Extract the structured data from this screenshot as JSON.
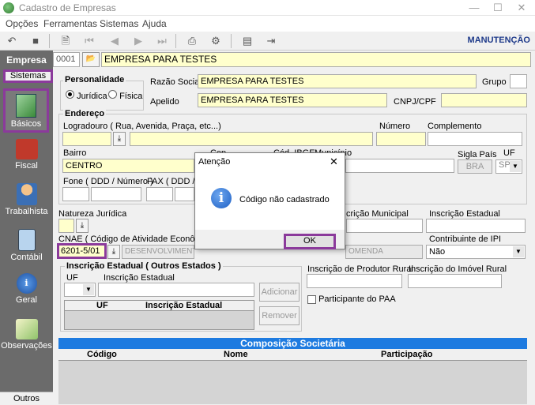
{
  "window": {
    "title": "Cadastro de Empresas"
  },
  "menu": {
    "items": [
      "Opções",
      "Ferramentas",
      "Sistemas",
      "Ajuda"
    ]
  },
  "toolbar": {
    "mode": "MANUTENÇÃO"
  },
  "empresa": {
    "tab": "Empresa",
    "code": "0001",
    "name": "EMPRESA PARA TESTES"
  },
  "sidebar": {
    "sistemas_tab": "Sistemas",
    "items": [
      "Básicos",
      "Fiscal",
      "Trabalhista",
      "Contábil",
      "Geral",
      "Observações"
    ],
    "outros": "Outros"
  },
  "personalidade": {
    "title": "Personalidade",
    "juridica": "Jurídica",
    "fisica": "Física"
  },
  "form": {
    "razao_social_label": "Razão Social",
    "razao_social": "EMPRESA PARA TESTES",
    "grupo_label": "Grupo",
    "apelido_label": "Apelido",
    "apelido": "EMPRESA PARA TESTES",
    "cnpj_label": "CNPJ/CPF"
  },
  "endereco": {
    "title": "Endereço",
    "logradouro_label": "Logradouro ( Rua, Avenida, Praça, etc...)",
    "numero_label": "Número",
    "complemento_label": "Complemento",
    "bairro_label": "Bairro",
    "bairro": "CENTRO",
    "cep_label": "Cep",
    "cod_ibge_label": "Cód. IBGE",
    "municipio_label": "Município",
    "sigla_pais_label": "Sigla País",
    "sigla_pais": "BRA",
    "uf_label": "UF",
    "uf": "SP",
    "fone_label": "Fone ( DDD / Número )",
    "fax_label": "FAX ( DDD / N"
  },
  "natureza": {
    "label": "Natureza Jurídica"
  },
  "inscricoes": {
    "municipal_label": "crição Municipal",
    "estadual_label": "Inscrição Estadual"
  },
  "cnae": {
    "label": "CNAE ( Código de Atividade Econômica",
    "code": "6201-5/01",
    "desc": "DESENVOLVIMENTO D",
    "desc_right": "OMENDA"
  },
  "ipi": {
    "label": "Contribuinte de IPI",
    "value": "Não"
  },
  "outros_estados": {
    "title": "Inscrição Estadual ( Outros Estados )",
    "uf_label": "UF",
    "ie_label": "Inscrição Estadual",
    "add": "Adicionar",
    "remove": "Remover",
    "col_uf": "UF",
    "col_ie": "Inscrição Estadual"
  },
  "rural": {
    "produtor_label": "Inscrição de Produtor Rural",
    "imovel_label": "Inscrição do Imóvel Rural",
    "paa": "Participante do PAA"
  },
  "composicao": {
    "title": "Composição Societária",
    "cols": [
      "Código",
      "Nome",
      "Participação"
    ]
  },
  "dialog": {
    "title": "Atenção",
    "message": "Código não cadastrado",
    "ok": "OK"
  }
}
